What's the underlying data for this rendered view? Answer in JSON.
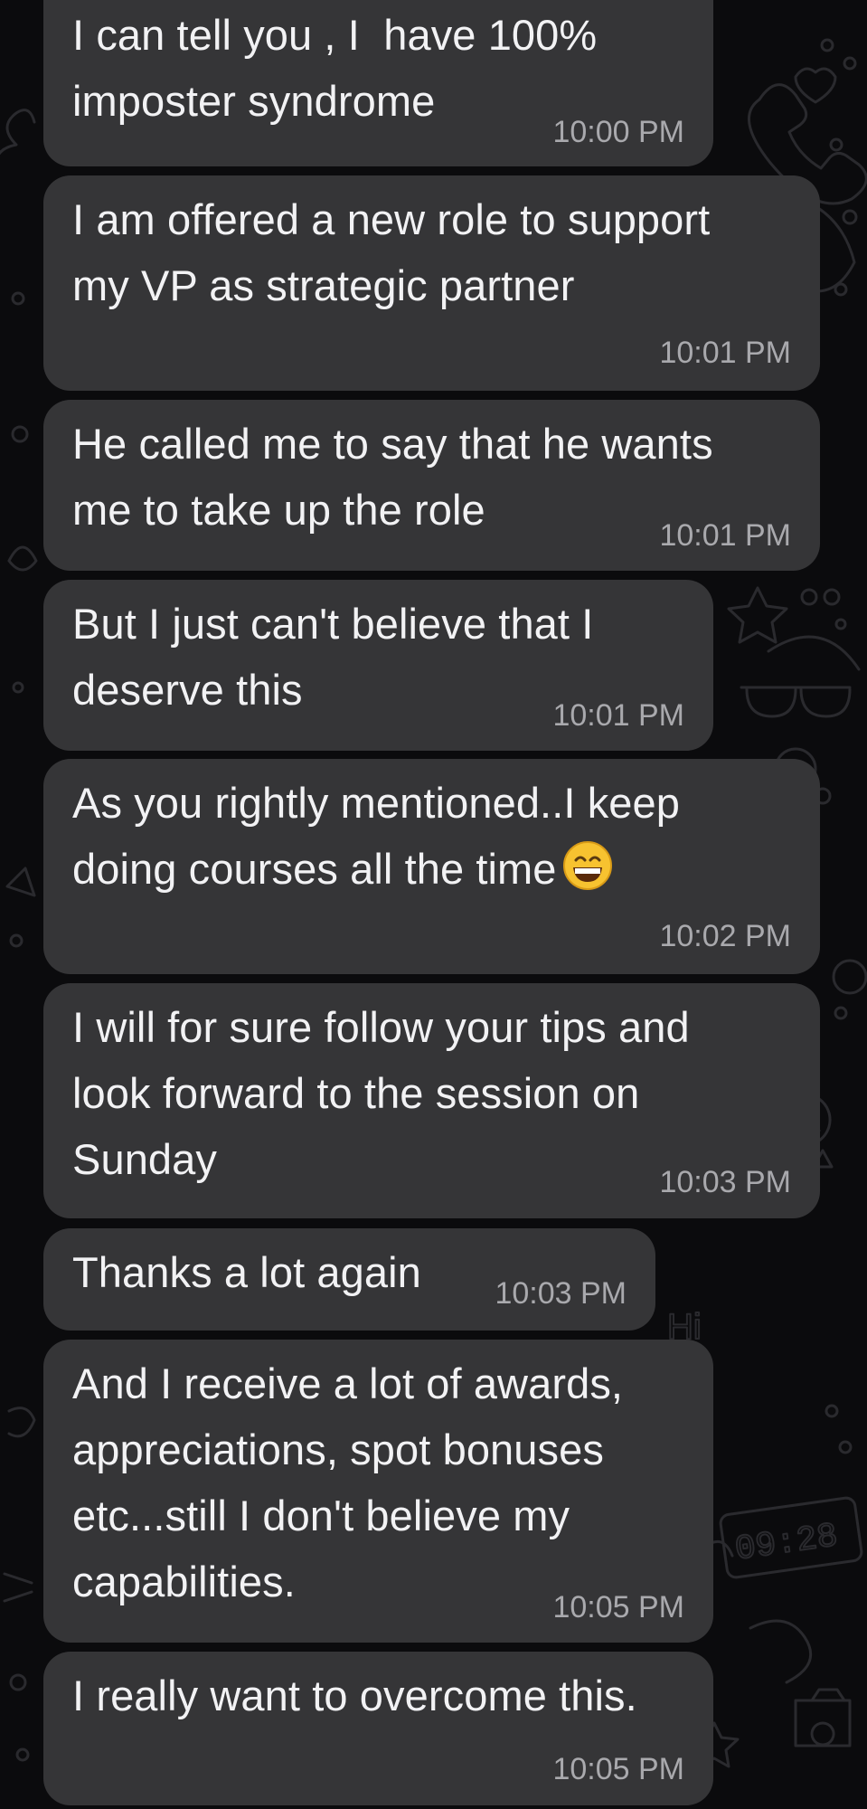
{
  "messages": [
    {
      "text": "I can tell you , I  have 100%\nimposter syndrome",
      "time": "10:00 PM"
    },
    {
      "text": "I am offered a new role to support\nmy VP as strategic partner",
      "time": "10:01 PM"
    },
    {
      "text": "He called me to say that he wants\nme to take up the role",
      "time": "10:01 PM"
    },
    {
      "text": "But I just can't believe that I\ndeserve this",
      "time": "10:01 PM"
    },
    {
      "text": "As you rightly mentioned..I keep\ndoing courses all the time",
      "time": "10:02 PM",
      "emoji": "grinning-face-emoji"
    },
    {
      "text": "I will for sure follow your tips and\nlook forward to the session on\nSunday",
      "time": "10:03 PM"
    },
    {
      "text": "Thanks a lot again",
      "time": "10:03 PM"
    },
    {
      "text": "And I receive a lot of awards,\nappreciations, spot bonuses\netc...still I don't believe my\ncapabilities.",
      "time": "10:05 PM"
    },
    {
      "text": "I really want to overcome this.",
      "time": "10:05 PM"
    }
  ],
  "wallpaper": {
    "doodle_text": [
      "Hi",
      "09:28"
    ],
    "icons": [
      "phone-icon",
      "heart-icon",
      "star-icon",
      "sunglasses-icon",
      "smiley-icon",
      "camera-icon",
      "clover-icon"
    ]
  },
  "colors": {
    "background": "#0b0b0d",
    "bubble": "#353537",
    "text": "#f2f2f4",
    "timestamp": "#a9a9ad",
    "doodle": "#2a2a2e"
  }
}
